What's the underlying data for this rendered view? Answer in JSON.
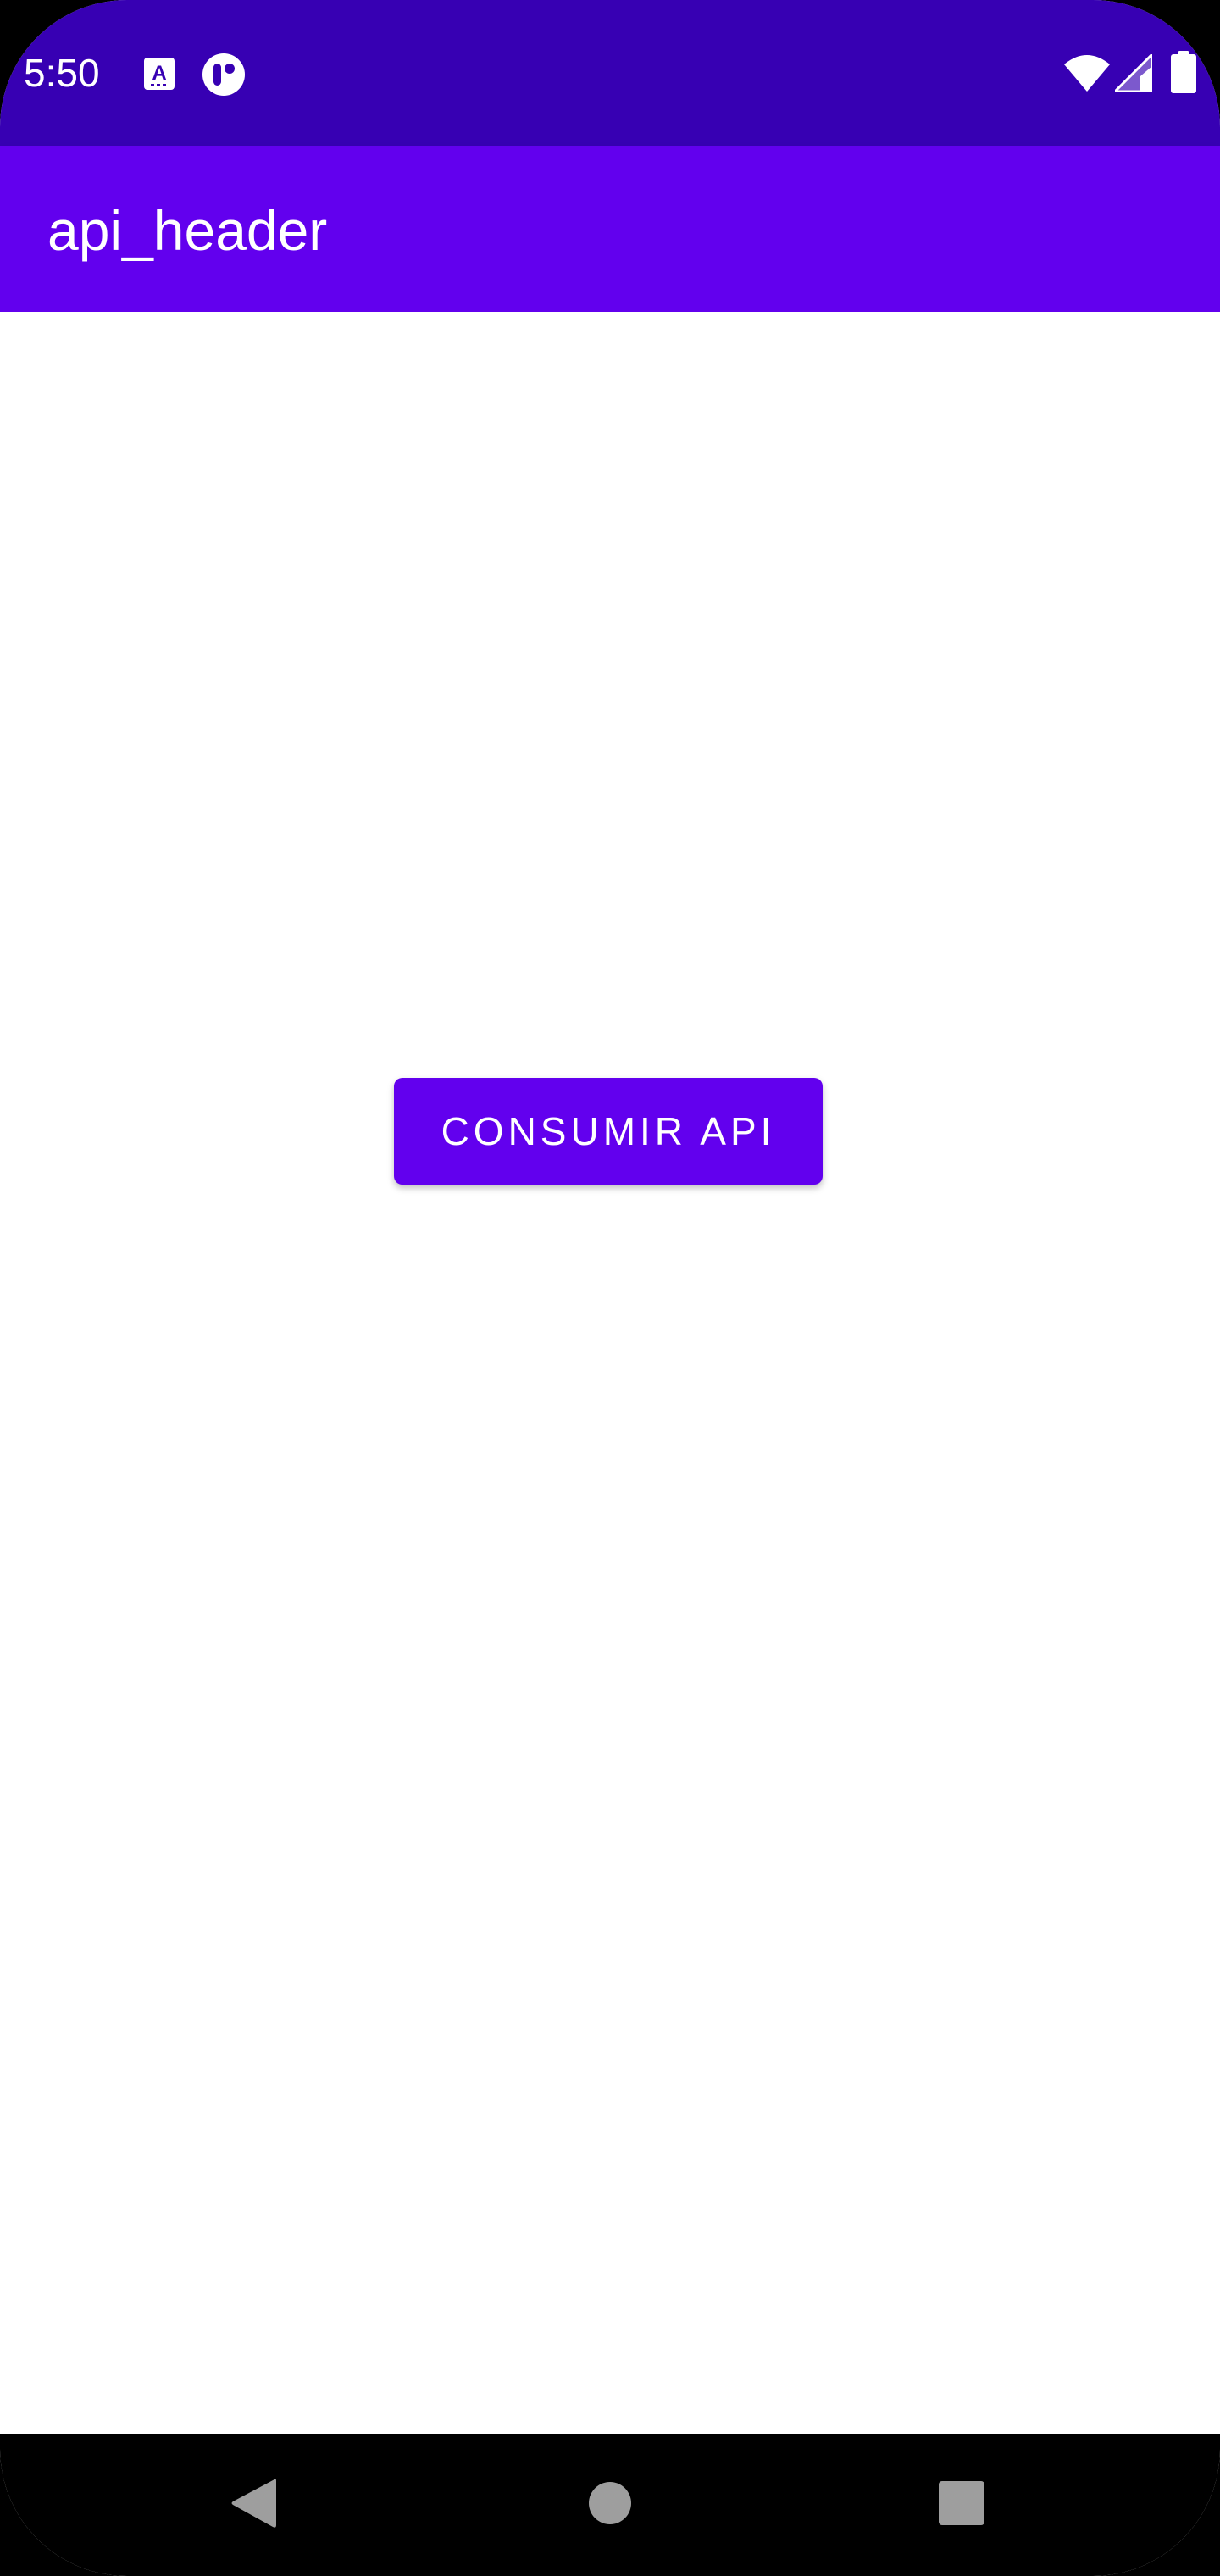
{
  "status_bar": {
    "time": "5:50",
    "icons": [
      "keyboard-a-icon",
      "app-notification-icon",
      "wifi-icon",
      "cell-signal-icon",
      "battery-icon"
    ],
    "background_color": "#3700B3"
  },
  "app_bar": {
    "title": "api_header",
    "background_color": "#6200EE"
  },
  "main": {
    "consume_button_label": "CONSUMIR API",
    "accent_color": "#6200EE"
  },
  "nav_bar": {
    "buttons": [
      "back-icon",
      "home-icon",
      "recents-icon"
    ]
  }
}
